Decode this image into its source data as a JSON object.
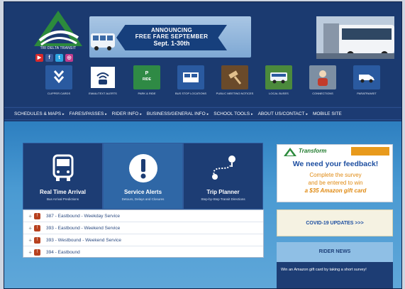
{
  "header": {
    "logo_text": "TRI DELTA TRANSIT",
    "social": [
      {
        "name": "youtube",
        "glyph": "▶",
        "color": "#d8282a"
      },
      {
        "name": "facebook",
        "glyph": "f",
        "color": "#3b5b9a"
      },
      {
        "name": "twitter",
        "glyph": "t",
        "color": "#2aa3e0"
      },
      {
        "name": "instagram",
        "glyph": "◎",
        "color": "#c23c8c"
      }
    ],
    "banner": {
      "line1": "ANNOUNCING",
      "line2": "FREE FARE SEPTEMBER",
      "line3": "Sept. 1-30th"
    }
  },
  "quick_icons": [
    {
      "label": "CLIPPER CARDS",
      "icon": "arrows-down-icon",
      "bg": "#2a5aa0"
    },
    {
      "label": "EMAIL/TEXT ALERTS",
      "icon": "wifi-bus-icon",
      "bg": "#ffffff"
    },
    {
      "label": "PARK & RIDE",
      "icon": "park-ride-icon",
      "bg": "#2f8a45"
    },
    {
      "label": "BUS STOP LOCATIONS",
      "icon": "bus-stop-icon",
      "bg": "#2a5aa0"
    },
    {
      "label": "PUBLIC MEETING NOTICES",
      "icon": "gavel-icon",
      "bg": "#6a4a2a"
    },
    {
      "label": "LOCAL BUSES",
      "icon": "bus-icon",
      "bg": "#4b8a3c"
    },
    {
      "label": "CONNECTIONS",
      "icon": "person-icon",
      "bg": "#7d8fa3"
    },
    {
      "label": "PARATRANSIT",
      "icon": "van-icon",
      "bg": "#2a5aa0"
    }
  ],
  "nav": [
    "SCHEDULES & MAPS",
    "FARES/PASSES",
    "RIDER INFO",
    "BUSINESS/GENERAL INFO",
    "SCHOOL TOOLS",
    "ABOUT US/CONTACT",
    "MOBILE SITE"
  ],
  "cards": [
    {
      "title": "Real Time Arrival",
      "subtitle": "Bus Arrival Predictions"
    },
    {
      "title": "Service Alerts",
      "subtitle": "Detours, Delays and Closures"
    },
    {
      "title": "Trip Planner",
      "subtitle": "Step-by-Step Transit Directions"
    }
  ],
  "routes": [
    "387 - Eastbound - Weekday Service",
    "393 - Eastbound - Weekend Service",
    "393 - Westbound - Weekend Service",
    "394 - Eastbound"
  ],
  "sidebar": {
    "feedback": {
      "logo": "Transform",
      "title": "We need your feedback!",
      "line1": "Complete the survey",
      "line2": "and be entered to win",
      "line3": "a $35 Amazon gift card"
    },
    "covid": "COVID-19 UPDATES >>>",
    "rider_news_title": "RIDER NEWS",
    "rider_news_text": "Win an Amazon gift card by taking a short survey!"
  },
  "colors": {
    "navy": "#1b3a70",
    "main_blue": "#4a9ad2",
    "route_badge": "#b7411f",
    "feedback_orange": "#e08a12"
  }
}
